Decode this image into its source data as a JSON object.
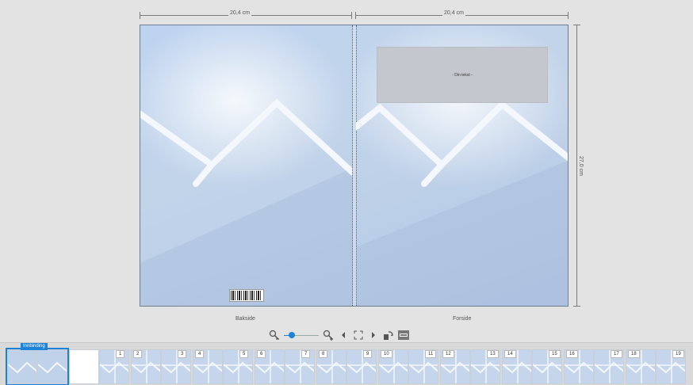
{
  "dimensions": {
    "width_back": "20,4 cm",
    "width_front": "20,4 cm",
    "height": "27,0 cm"
  },
  "cover": {
    "back_label": "Bakside",
    "front_label": "Forside",
    "text_placeholder": "- Din tekst -"
  },
  "toolbar": {
    "zoom_out_icon": "zoom-out-icon",
    "zoom_in_icon": "zoom-in-icon",
    "zoom_level": 0.1,
    "prev_icon": "chevron-left-icon",
    "fullscreen_icon": "fullscreen-icon",
    "next_icon": "chevron-right-icon",
    "rotate_icon": "rotate-icon",
    "view_icon": "view-mode-icon"
  },
  "filmstrip": {
    "first_label": "Innbinding",
    "page_numbers": [
      "1",
      "2",
      "3",
      "4",
      "5",
      "6",
      "7",
      "8",
      "9",
      "10",
      "11",
      "12",
      "13",
      "14",
      "15",
      "16",
      "17",
      "18",
      "19"
    ]
  },
  "colors": {
    "accent": "#1e82d6",
    "sky": "#bdd3ef",
    "text_box": "#c4c8ce"
  }
}
